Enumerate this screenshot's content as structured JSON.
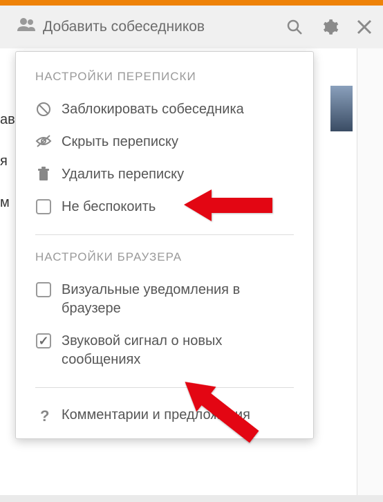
{
  "header": {
    "add_label": "Добавить собеседников"
  },
  "dropdown": {
    "section1_label": "НАСТРОЙКИ ПЕРЕПИСКИ",
    "items1": [
      {
        "label": "Заблокировать собеседника"
      },
      {
        "label": "Скрыть переписку"
      },
      {
        "label": "Удалить переписку"
      },
      {
        "label": "Не беспокоить"
      }
    ],
    "section2_label": "НАСТРОЙКИ БРАУЗЕРА",
    "items2": [
      {
        "label": "Визуальные уведомления в браузере"
      },
      {
        "label": "Звуковой сигнал о новых сообщениях"
      }
    ],
    "footer_label": "Комментарии и предложения"
  },
  "bg": {
    "tab1": "ав",
    "tab2": "я",
    "tab3": "м"
  },
  "colors": {
    "accent": "#ee8208",
    "arrow": "#e30613"
  }
}
